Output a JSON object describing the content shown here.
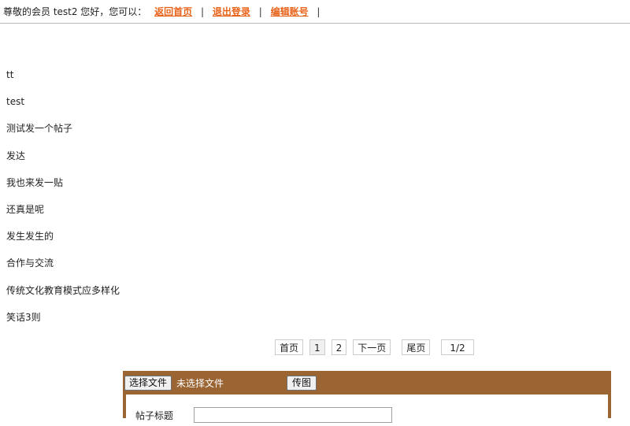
{
  "topbar": {
    "greeting": "尊敬的会员 test2 您好，您可以：",
    "links": [
      {
        "label": "返回首页"
      },
      {
        "label": "退出登录"
      },
      {
        "label": "编辑账号"
      }
    ],
    "separator": "|"
  },
  "posts": [
    {
      "title": "tt"
    },
    {
      "title": "test"
    },
    {
      "title": "测试发一个帖子"
    },
    {
      "title": "发达"
    },
    {
      "title": "我也来发一贴"
    },
    {
      "title": "还真是呢"
    },
    {
      "title": "发生发生的"
    },
    {
      "title": "合作与交流"
    },
    {
      "title": "传统文化教育模式应多样化"
    },
    {
      "title": "笑话3则"
    }
  ],
  "pagination": {
    "first": "首页",
    "pages": [
      "1",
      "2"
    ],
    "next": "下一页",
    "last": "尾页",
    "info": "1/2"
  },
  "form": {
    "file_button": "选择文件",
    "file_status": "未选择文件",
    "upload_button": "传图",
    "title_label": "帖子标题",
    "title_value": ""
  },
  "colors": {
    "link": "#e8631a",
    "panel": "#9a6433"
  }
}
